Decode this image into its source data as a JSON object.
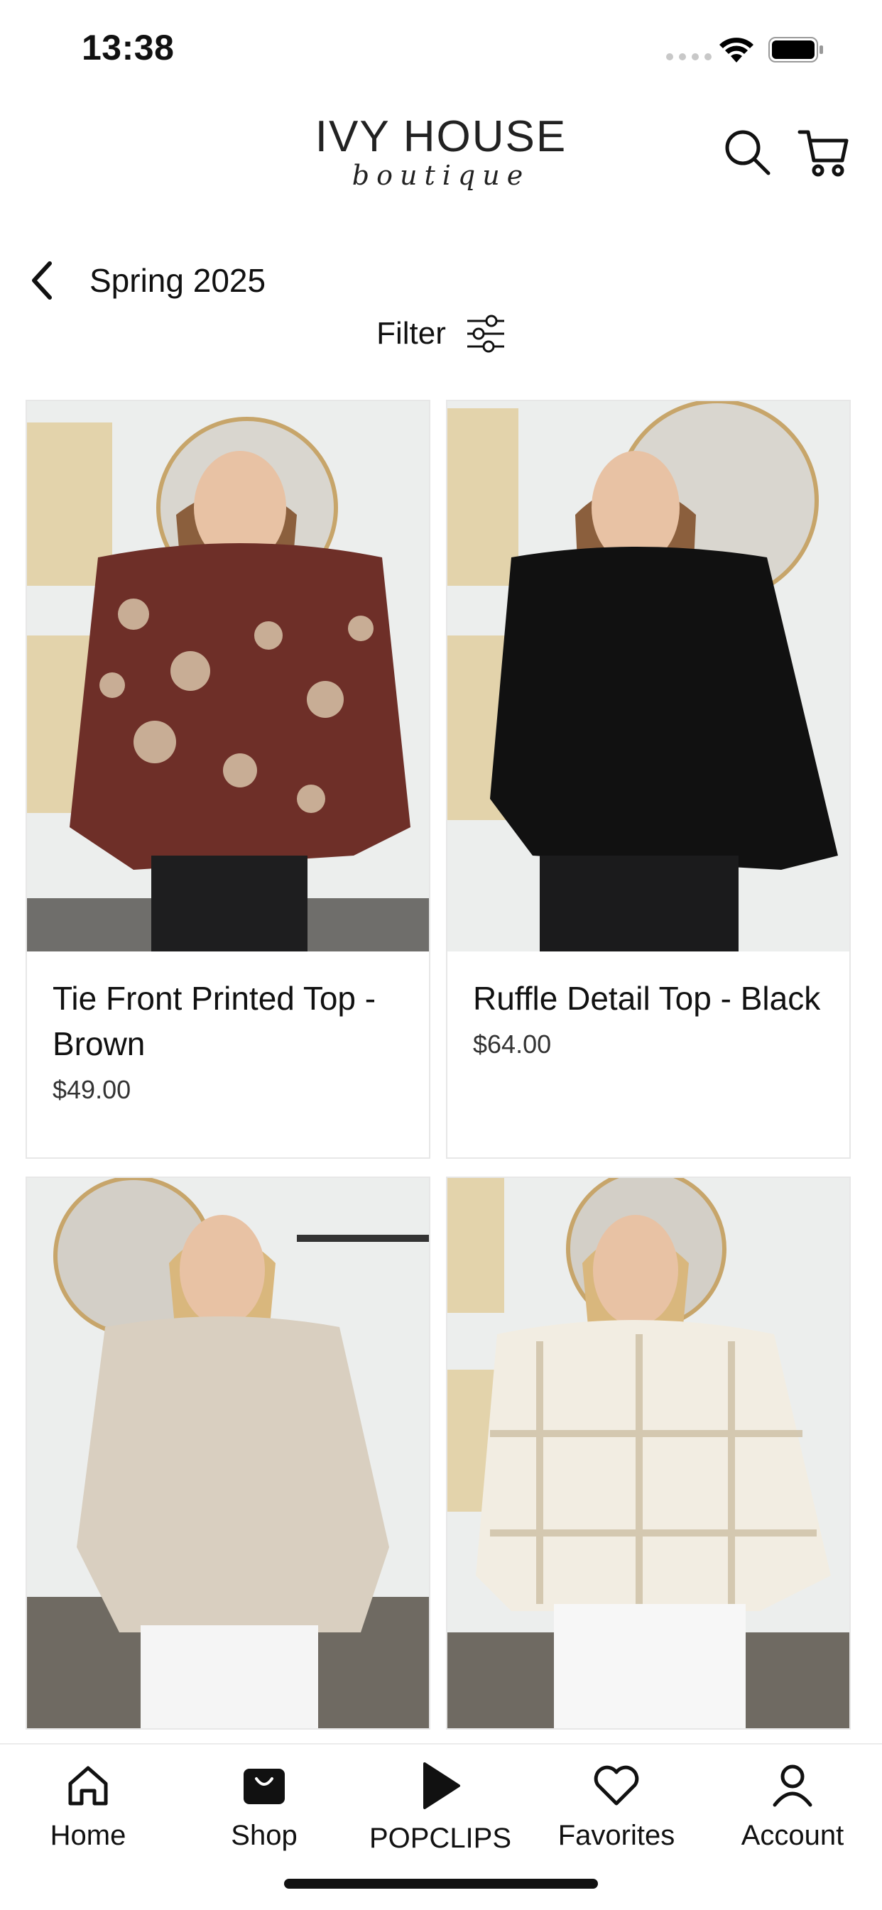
{
  "status_bar": {
    "time": "13:38"
  },
  "header": {
    "logo_main": "IVY HOUSE",
    "logo_sub": "boutique",
    "search_icon": "search-icon",
    "cart_icon": "cart-icon"
  },
  "collection": {
    "title": "Spring 2025",
    "filter_label": "Filter"
  },
  "products": [
    {
      "name": "Tie Front Printed Top - Brown",
      "price": "$49.00"
    },
    {
      "name": "Ruffle Detail Top - Black",
      "price": "$64.00"
    },
    {
      "name": "",
      "price": ""
    },
    {
      "name": "",
      "price": ""
    }
  ],
  "tabbar": {
    "items": [
      {
        "label": "Home",
        "icon": "home-icon"
      },
      {
        "label": "Shop",
        "icon": "shop-bag-icon"
      },
      {
        "label": "POPCLIPS",
        "icon": "play-icon"
      },
      {
        "label": "Favorites",
        "icon": "heart-icon"
      },
      {
        "label": "Account",
        "icon": "person-icon"
      }
    ]
  },
  "colors": {
    "accent": "#111111",
    "card_border": "#e7e7e7",
    "background": "#ffffff"
  }
}
